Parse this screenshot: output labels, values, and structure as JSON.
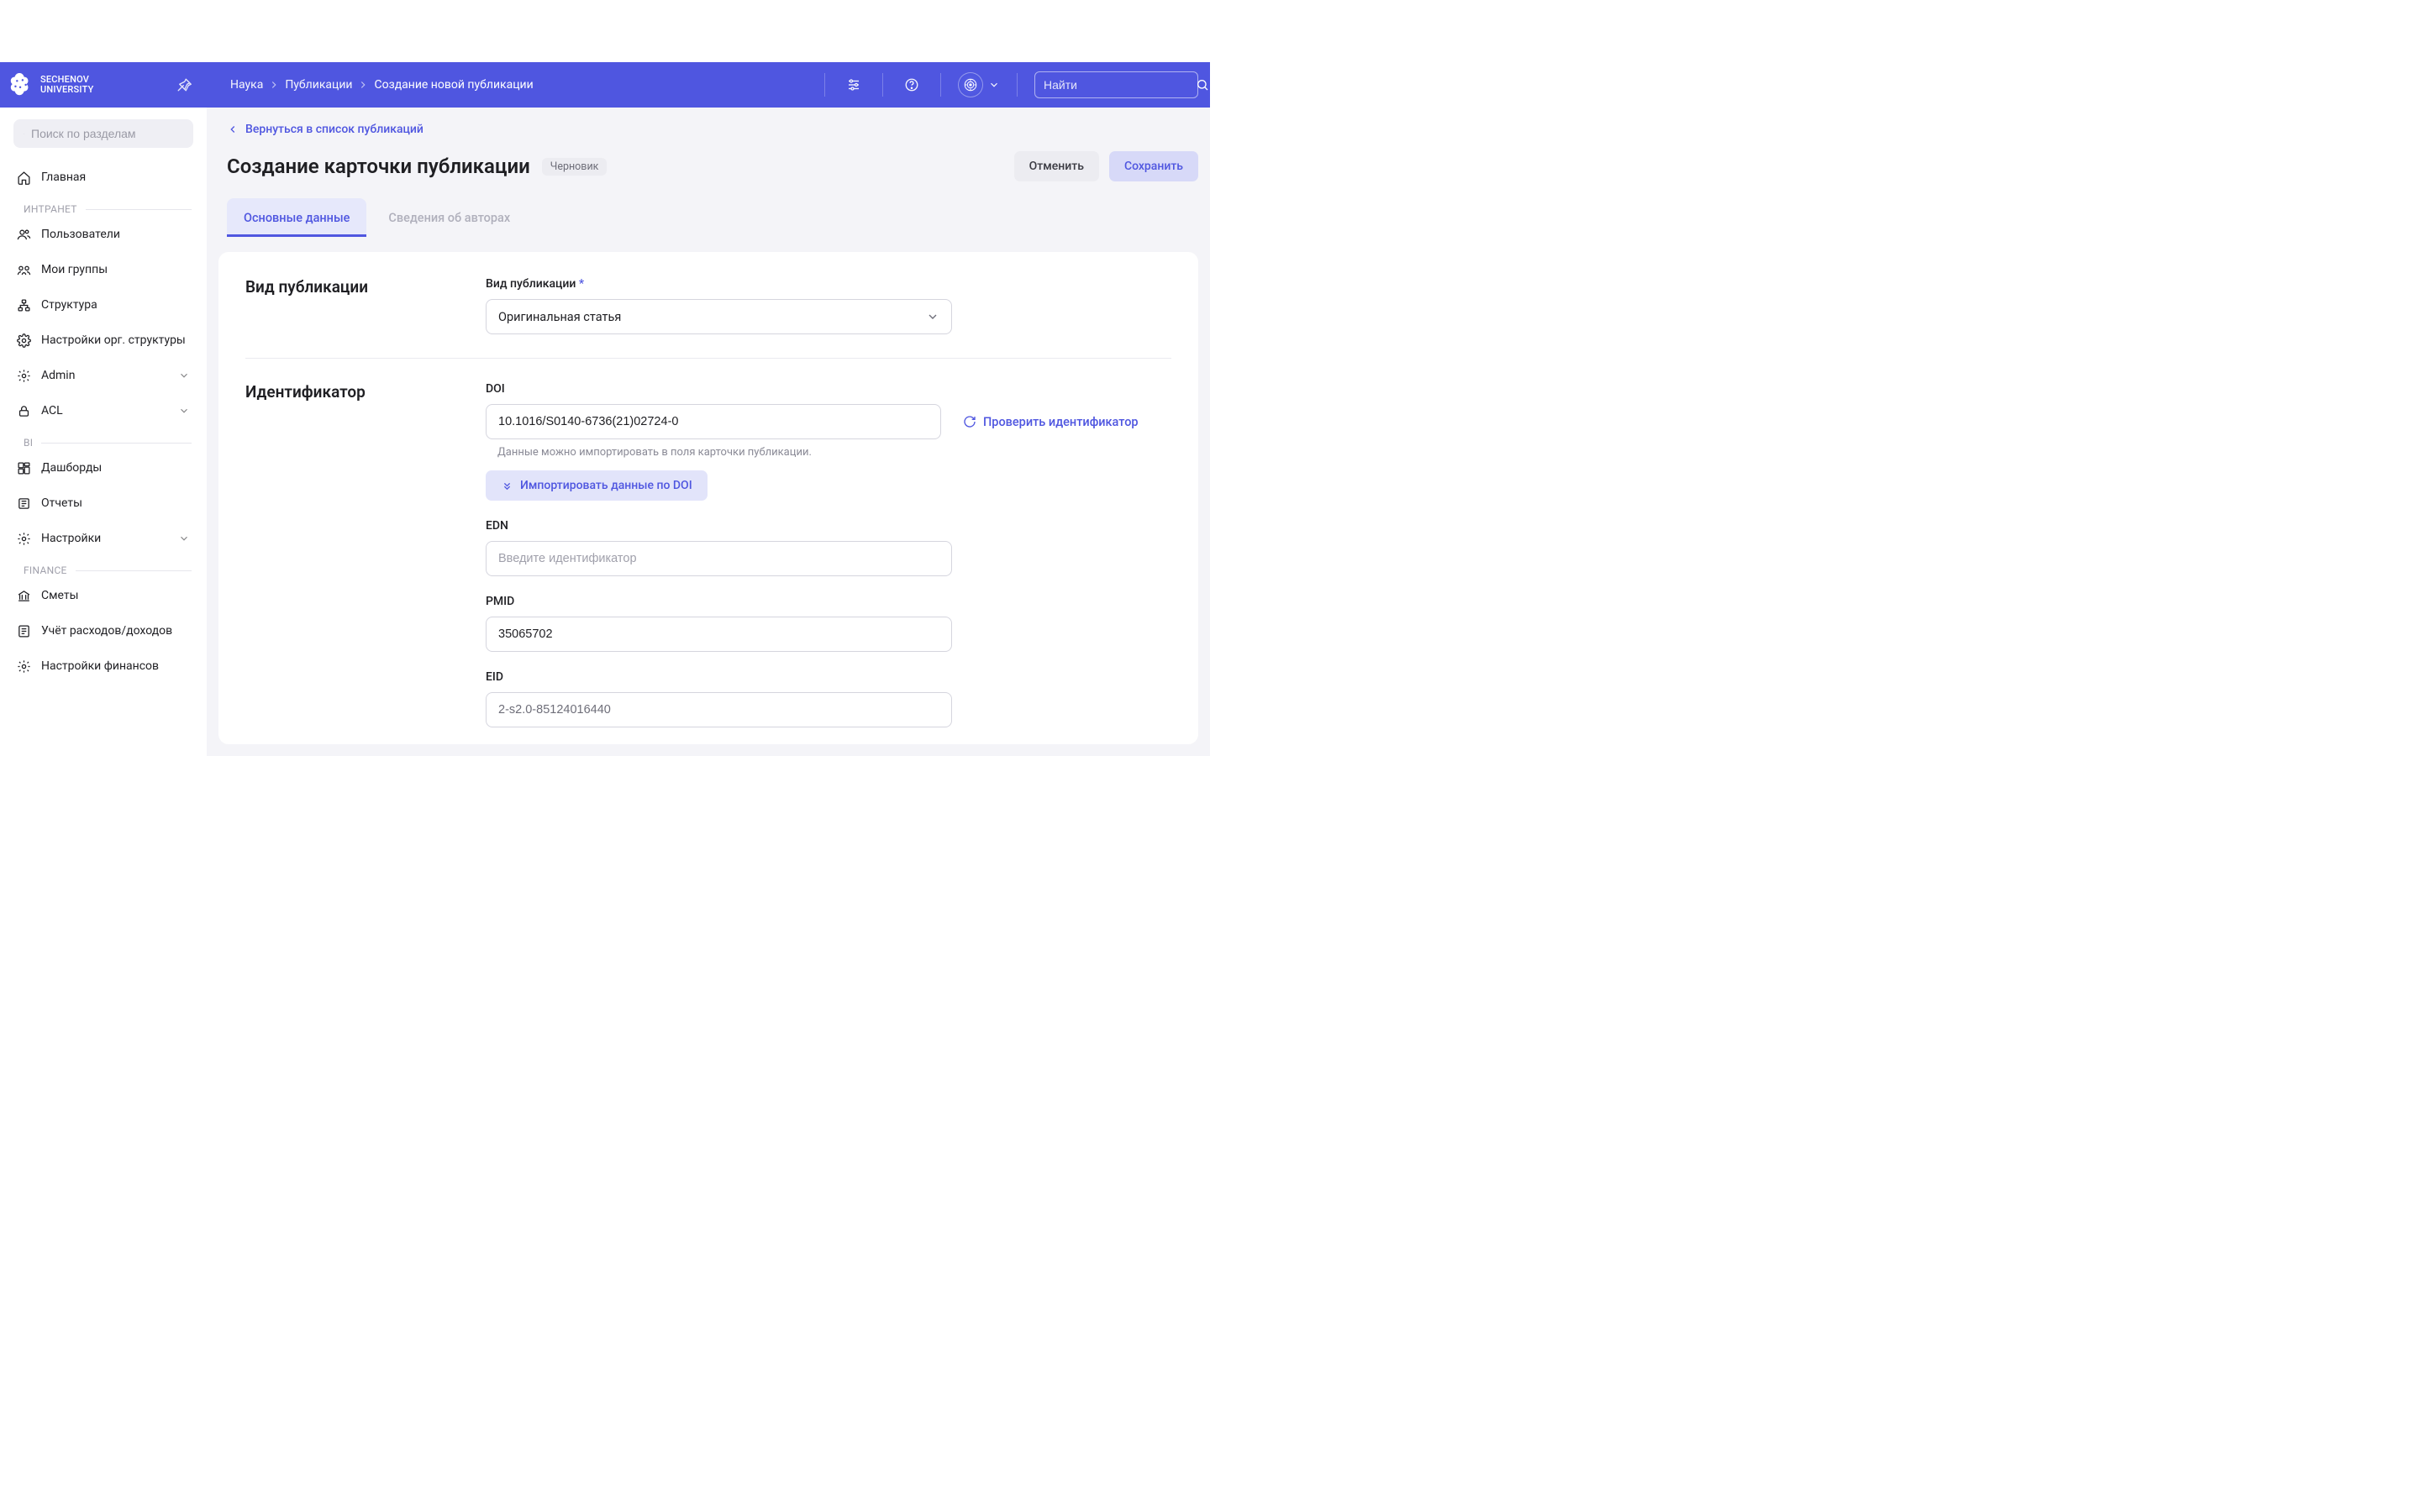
{
  "brand": {
    "line1": "SECHENOV",
    "line2": "UNIVERSITY"
  },
  "breadcrumbs": {
    "science": "Наука",
    "pubs": "Публикации",
    "create": "Создание новой публикации"
  },
  "header_search_placeholder": "Найти",
  "sidebar": {
    "search_placeholder": "Поиск по разделам",
    "home": "Главная",
    "group_intranet": "ИНТРАНЕТ",
    "users": "Пользователи",
    "my_groups": "Мои группы",
    "structure": "Структура",
    "org_settings": "Настройки орг. структуры",
    "admin": "Admin",
    "acl": "ACL",
    "group_bi": "BI",
    "dashboards": "Дашборды",
    "reports": "Отчеты",
    "settings": "Настройки",
    "group_finance": "FINANCE",
    "budgets": "Сметы",
    "income_expenses": "Учёт расходов/доходов",
    "finance_settings": "Настройки финансов"
  },
  "page": {
    "backlink": "Вернуться в список публикаций",
    "title": "Создание карточки публикации",
    "draft_badge": "Черновик",
    "cancel": "Отменить",
    "save": "Сохранить"
  },
  "tabs": {
    "main": "Основные данные",
    "authors": "Сведения об авторах"
  },
  "form": {
    "pub_type_section": "Вид публикации",
    "pub_type_label": "Вид публикации",
    "pub_type_value": "Оригинальная статья",
    "id_section": "Идентификатор",
    "doi_label": "DOI",
    "doi_value": "10.1016/S0140-6736(21)02724-0",
    "verify_label": "Проверить идентификатор",
    "hint": "Данные можно импортировать в поля карточки публикации.",
    "import_label": "Импортировать данные по DOI",
    "edn_label": "EDN",
    "edn_placeholder": "Введите идентификатор",
    "pmid_label": "PMID",
    "pmid_value": "35065702",
    "eid_label": "EID",
    "eid_value": "2-s2.0-85124016440"
  }
}
